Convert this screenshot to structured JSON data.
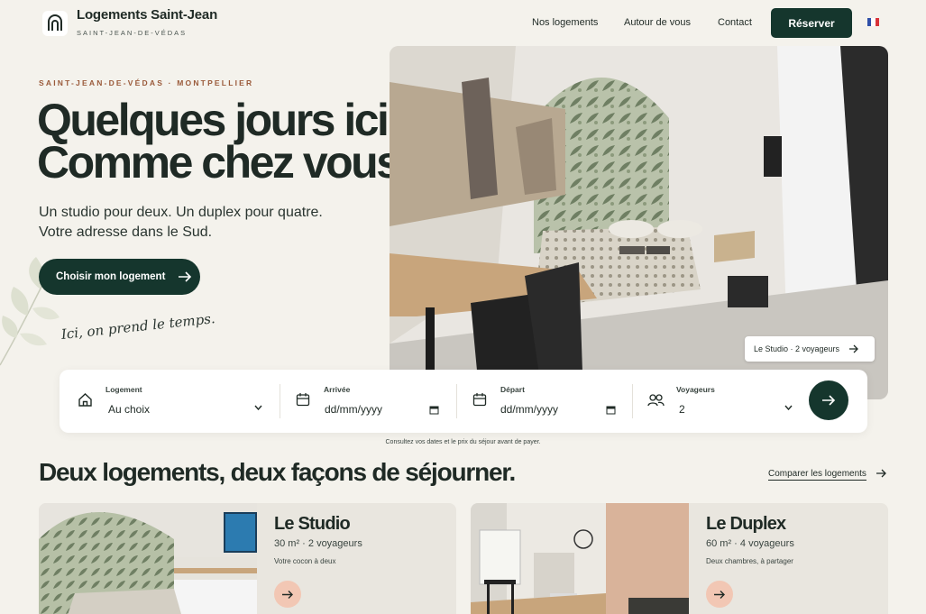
{
  "header": {
    "brand_title": "Logements Saint-Jean",
    "brand_subtitle": "SAINT-JEAN-DE-VÉDAS",
    "nav": [
      "Nos logements",
      "Autour de vous",
      "Contact"
    ],
    "reserve_label": "Réserver",
    "language_icon": "flag-fr-icon"
  },
  "hero": {
    "eyebrow": "SAINT-JEAN-DE-VÉDAS · MONTPELLIER",
    "title_line1": "Quelques jours ici.",
    "title_line2": "Comme chez vous.",
    "subtitle_line1": "Un studio pour deux. Un duplex pour quatre.",
    "subtitle_line2": "Votre adresse dans le Sud.",
    "cta_label": "Choisir mon logement",
    "script_text": "Ici, on prend le temps.",
    "image_tag": "Le Studio · 2 voyageurs"
  },
  "booking": {
    "logement_label": "Logement",
    "logement_value": "Au choix",
    "arrivee_label": "Arrivée",
    "arrivee_placeholder": "dd/mm/yyyy",
    "depart_label": "Départ",
    "depart_placeholder": "dd/mm/yyyy",
    "voyageurs_label": "Voyageurs",
    "voyageurs_value": "2",
    "hint": "Consultez vos dates et le prix du séjour avant de payer."
  },
  "section": {
    "title": "Deux logements, deux façons de séjourner.",
    "compare_label": "Comparer les logements"
  },
  "cards": [
    {
      "title": "Le Studio",
      "meta": "30 m² · 2 voyageurs",
      "desc": "Votre cocon à deux"
    },
    {
      "title": "Le Duplex",
      "meta": "60 m² · 4 voyageurs",
      "desc": "Deux chambres, à partager"
    }
  ],
  "colors": {
    "primary": "#15362d",
    "accent": "#9a5a3a",
    "background": "#f4f2ec",
    "card_button": "#f2c7b4"
  }
}
